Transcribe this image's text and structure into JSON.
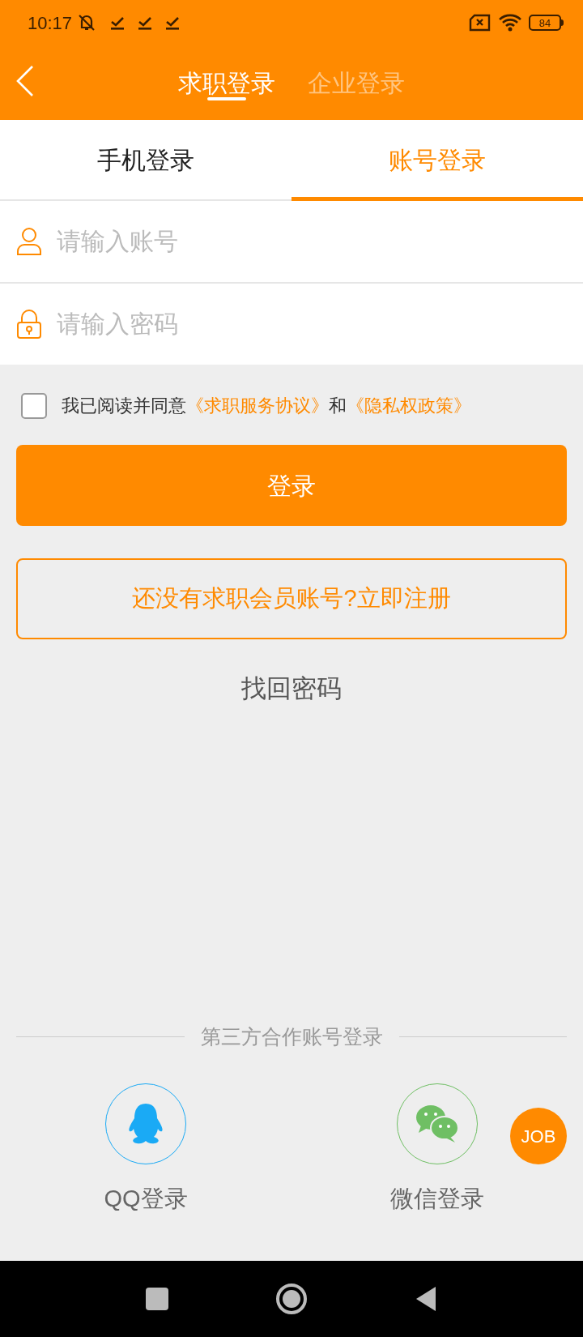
{
  "status_bar": {
    "time": "10:17",
    "battery": "84"
  },
  "header": {
    "tabs": [
      {
        "label": "求职登录",
        "selected": true
      },
      {
        "label": "企业登录",
        "selected": false
      }
    ]
  },
  "login_tabs": [
    {
      "label": "手机登录",
      "selected": false
    },
    {
      "label": "账号登录",
      "selected": true
    }
  ],
  "fields": [
    {
      "kind": "account",
      "placeholder": "请输入账号"
    },
    {
      "kind": "password",
      "placeholder": "请输入密码"
    }
  ],
  "agreement": {
    "checked": false,
    "prefix": "我已阅读并同意",
    "link_1": "《求职服务协议》",
    "conjunction": "和",
    "link_2": "《隐私权政策》"
  },
  "login_button": "登录",
  "register_button": "还没有求职会员账号?立即注册",
  "forgot_password": "找回密码",
  "third_party": {
    "title": "第三方合作账号登录",
    "options": [
      {
        "kind": "qq",
        "label": "QQ登录"
      },
      {
        "kind": "wechat",
        "label": "微信登录"
      }
    ]
  },
  "float_badge": "JOB"
}
